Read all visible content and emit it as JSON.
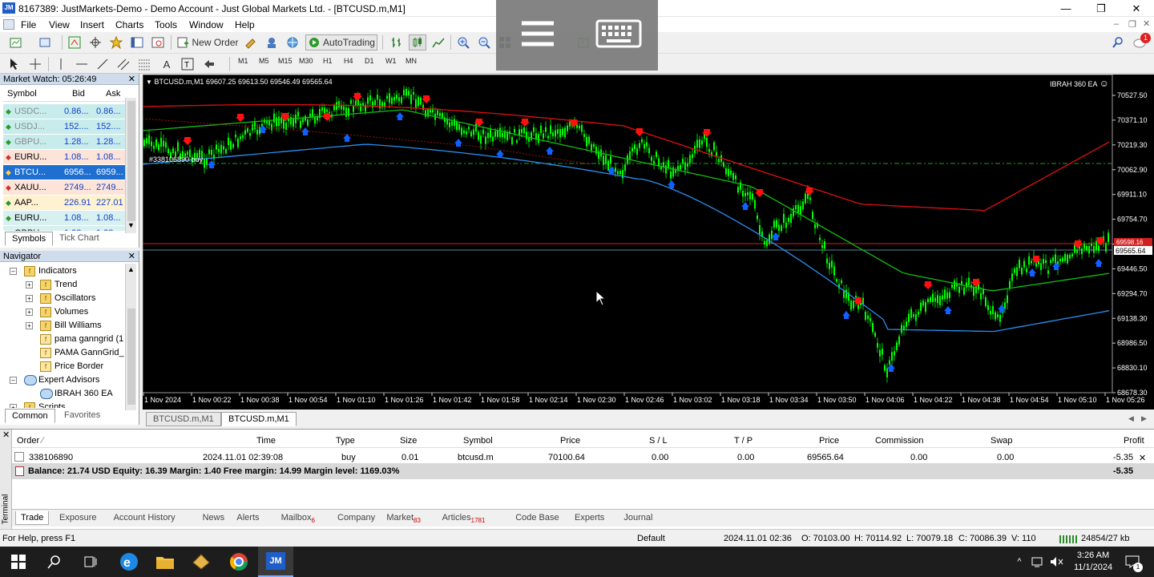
{
  "window": {
    "title": "8167389: JustMarkets-Demo - Demo Account - Just Global Markets Ltd. - [BTCUSD.m,M1]",
    "app_badge": "JM"
  },
  "menu": [
    "File",
    "View",
    "Insert",
    "Charts",
    "Tools",
    "Window",
    "Help"
  ],
  "toolbar": {
    "new_order": "New Order",
    "autotrading": "AutoTrading",
    "notification_count": "1"
  },
  "timeframes": [
    "M1",
    "M5",
    "M15",
    "M30",
    "H1",
    "H4",
    "D1",
    "W1",
    "MN"
  ],
  "market_watch": {
    "title": "Market Watch: 05:26:49",
    "headers": [
      "Symbol",
      "Bid",
      "Ask"
    ],
    "rows": [
      {
        "symbol": "USDC...",
        "bid": "0.86...",
        "ask": "0.86..."
      },
      {
        "symbol": "USDJ...",
        "bid": "152....",
        "ask": "152...."
      },
      {
        "symbol": "GBPU...",
        "bid": "1.28...",
        "ask": "1.28..."
      },
      {
        "symbol": "EURU...",
        "bid": "1.08...",
        "ask": "1.08..."
      },
      {
        "symbol": "BTCU...",
        "bid": "6956...",
        "ask": "6959..."
      },
      {
        "symbol": "XAUU...",
        "bid": "2749...",
        "ask": "2749..."
      },
      {
        "symbol": "AAP...",
        "bid": "226.91",
        "ask": "227.01"
      },
      {
        "symbol": "EURU...",
        "bid": "1.08...",
        "ask": "1.08..."
      },
      {
        "symbol": "GBPU...",
        "bid": "1.28...",
        "ask": "1.28..."
      }
    ],
    "tabs": [
      "Symbols",
      "Tick Chart"
    ]
  },
  "navigator": {
    "title": "Navigator",
    "items": [
      {
        "label": "Indicators"
      },
      {
        "label": "Trend"
      },
      {
        "label": "Oscillators"
      },
      {
        "label": "Volumes"
      },
      {
        "label": "Bill Williams"
      },
      {
        "label": "pama ganngrid (1"
      },
      {
        "label": "PAMA GannGrid_"
      },
      {
        "label": "Price Border"
      },
      {
        "label": "Expert Advisors"
      },
      {
        "label": "IBRAH 360 EA"
      },
      {
        "label": "Scripts"
      }
    ],
    "tabs": [
      "Common",
      "Favorites"
    ]
  },
  "chart": {
    "header": "BTCUSD.m,M1  69607.25 69613.50 69546.49 69565.64",
    "ea_label": "IBRAH 360 EA",
    "order_line_label": "#338106890 buy",
    "price_axis": [
      "70527.50",
      "70371.10",
      "70219.30",
      "70062.90",
      "69911.10",
      "69754.70",
      "69598.30",
      "69446.50",
      "69294.70",
      "69138.30",
      "68986.50",
      "68830.10",
      "68678.30"
    ],
    "ask_tag": "69598.16",
    "current_price": "69565.64",
    "time_axis": [
      "1 Nov 2024",
      "1 Nov 00:22",
      "1 Nov 00:38",
      "1 Nov 00:54",
      "1 Nov 01:10",
      "1 Nov 01:26",
      "1 Nov 01:42",
      "1 Nov 01:58",
      "1 Nov 02:14",
      "1 Nov 02:30",
      "1 Nov 02:46",
      "1 Nov 03:02",
      "1 Nov 03:18",
      "1 Nov 03:34",
      "1 Nov 03:50",
      "1 Nov 04:06",
      "1 Nov 04:22",
      "1 Nov 04:38",
      "1 Nov 04:54",
      "1 Nov 05:10",
      "1 Nov 05:26"
    ],
    "tabs": [
      "BTCUSD.m,M1",
      "BTCUSD.m,M1"
    ],
    "colors": {
      "bg": "#000000",
      "candles": "#00ff00",
      "ma_red": "#e01010",
      "ma_green": "#10c010",
      "ma_blue": "#2a8ff0",
      "buy_arrow": "#1060ff",
      "sell_arrow": "#ff1010"
    }
  },
  "terminal": {
    "headers": [
      "Order",
      "Time",
      "Type",
      "Size",
      "Symbol",
      "Price",
      "S / L",
      "T / P",
      "Price",
      "Commission",
      "Swap",
      "Profit"
    ],
    "row": {
      "order": "338106890",
      "time": "2024.11.01 02:39:08",
      "type": "buy",
      "size": "0.01",
      "symbol": "btcusd.m",
      "price": "70100.64",
      "sl": "0.00",
      "tp": "0.00",
      "current": "69565.64",
      "commission": "0.00",
      "swap": "0.00",
      "profit": "-5.35"
    },
    "balance": "Balance: 21.74 USD  Equity: 16.39  Margin: 1.40  Free margin: 14.99  Margin level: 1169.03%",
    "balance_profit": "-5.35",
    "tabs": [
      {
        "label": "Trade"
      },
      {
        "label": "Exposure"
      },
      {
        "label": "Account History"
      },
      {
        "label": "News"
      },
      {
        "label": "Alerts"
      },
      {
        "label": "Mailbox",
        "badge": "6"
      },
      {
        "label": "Company"
      },
      {
        "label": "Market",
        "badge": "83"
      },
      {
        "label": "Articles",
        "badge": "1781"
      },
      {
        "label": "Code Base"
      },
      {
        "label": "Experts"
      },
      {
        "label": "Journal"
      }
    ],
    "side_label": "Terminal"
  },
  "status": {
    "help": "For Help, press F1",
    "profile": "Default",
    "datetime": "2024.11.01 02:36",
    "open": "O: 70103.00",
    "high": "H: 70114.92",
    "low": "L: 70079.18",
    "close": "C: 70086.39",
    "volume": "V: 110",
    "traffic": "24854/27 kb"
  },
  "taskbar": {
    "time": "3:26 AM",
    "date": "11/1/2024",
    "jm_label": "JM"
  }
}
